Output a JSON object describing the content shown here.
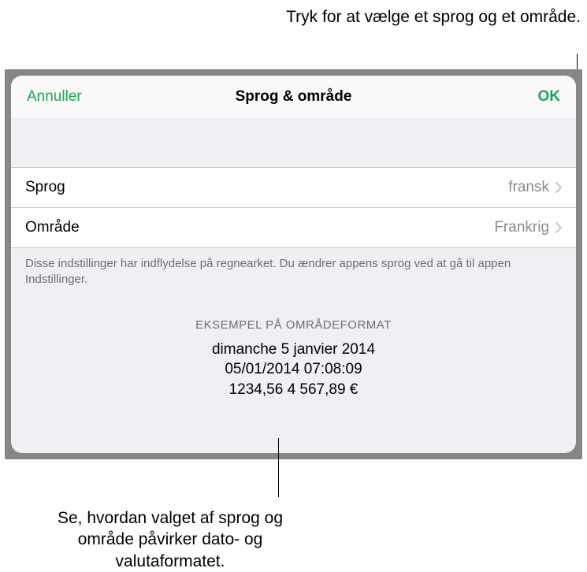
{
  "callouts": {
    "top": "Tryk for at vælge et sprog og et område.",
    "bottom": "Se, hvordan valget af sprog og område påvirker dato- og valutaformatet."
  },
  "nav": {
    "cancel": "Annuller",
    "title": "Sprog & område",
    "ok": "OK"
  },
  "rows": {
    "language": {
      "label": "Sprog",
      "value": "fransk"
    },
    "region": {
      "label": "Område",
      "value": "Frankrig"
    }
  },
  "footerNote": "Disse indstillinger har indflydelse på regnearket. Du ændrer appens sprog ved at gå til appen Indstillinger.",
  "example": {
    "header": "EKSEMPEL PÅ OMRÅDEFORMAT",
    "line1": "dimanche 5 janvier 2014",
    "line2": "05/01/2014   07:08:09",
    "line3": "1234,56   4 567,89 €"
  }
}
